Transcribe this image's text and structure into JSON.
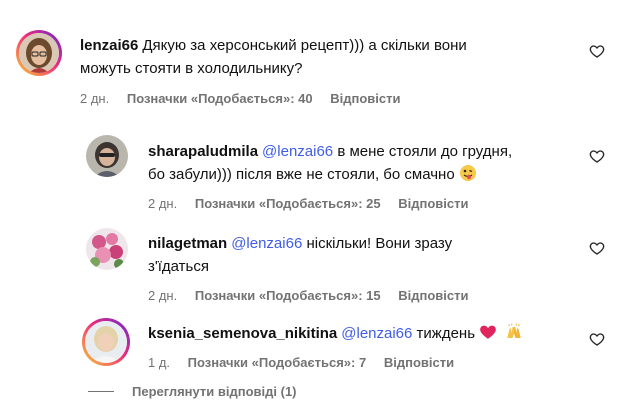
{
  "comments": [
    {
      "username": "lenzai66",
      "text_line1": "Дякую за херсонський рецепт))) а скільки вони",
      "text_line2": "можуть стояти в холодильнику?",
      "time": "2 дн.",
      "likes": "Позначки «Подобається»: 40",
      "reply": "Відповісти"
    },
    {
      "username": "sharapaludmila",
      "mention": "@lenzai66",
      "text_line1": "в мене стояли до грудня,",
      "text_line2": "бо забули))) після вже не стояли, бо смачно",
      "emoji": "😜",
      "time": "2 дн.",
      "likes": "Позначки «Подобається»: 25",
      "reply": "Відповісти"
    },
    {
      "username": "nilagetman",
      "mention": "@lenzai66",
      "text_line1": "ніскільки! Вони зразу",
      "text_line2": "з'їдаться",
      "time": "2 дн.",
      "likes": "Позначки «Подобається»: 15",
      "reply": "Відповісти"
    },
    {
      "username": "ksenia_semenova_nikitina",
      "mention": "@lenzai66",
      "text_line1": "тиждень",
      "emoji1": "❤️",
      "emoji2": "🙌",
      "time": "1 д.",
      "likes": "Позначки «Подобається»: 7",
      "reply": "Відповісти"
    }
  ],
  "view_replies": "Переглянути відповіді (1)",
  "icons": {
    "like": "heart-outline-icon"
  },
  "colors": {
    "mention": "#405de6",
    "meta": "#737373",
    "story_ring_start": "#f9ce34",
    "story_ring_end": "#6228d7"
  }
}
